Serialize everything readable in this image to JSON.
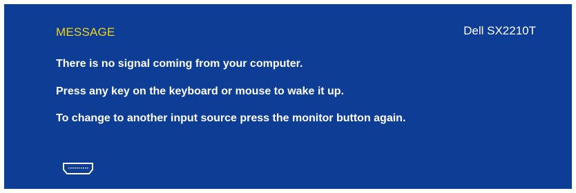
{
  "osd": {
    "title": "MESSAGE",
    "model": "Dell SX2210T",
    "lines": [
      "There is no signal coming from your computer.",
      "Press any key on the keyboard or mouse to wake it up.",
      "To change to another input source press the monitor button again."
    ],
    "input_icon": "hdmi-connector-icon"
  },
  "colors": {
    "background": "#0d3d95",
    "title": "#f2d21a",
    "text": "#ffffff"
  }
}
